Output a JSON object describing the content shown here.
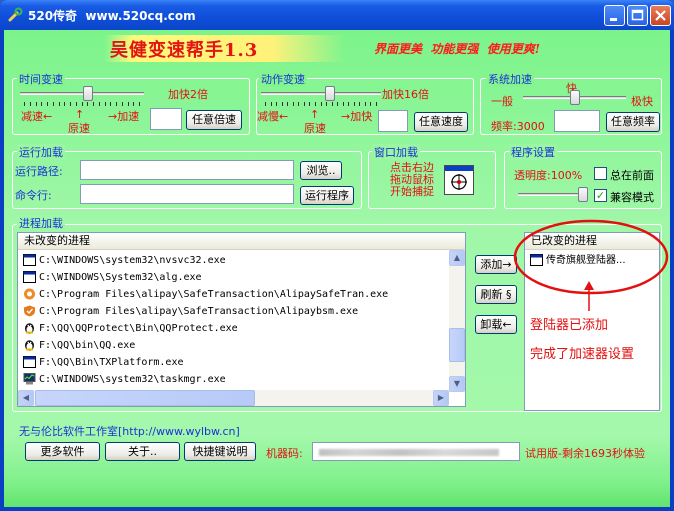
{
  "window": {
    "title": "520传奇  www.520cq.com",
    "banner": "吴健变速帮手1.3",
    "slogan": "界面更美  功能更强  使用更爽!"
  },
  "time_speed": {
    "label": "时间变速",
    "fast_label": "加快2倍",
    "decrease": "减速←",
    "original": "原速",
    "increase": "→加速",
    "value": "",
    "button": "任意倍速",
    "slider_fraction": 0.55
  },
  "action_speed": {
    "label": "动作变速",
    "fast_label": "加快16倍",
    "decrease": "减慢←",
    "original": "原速",
    "increase": "→加快",
    "value": "",
    "button": "任意速度",
    "slider_fraction": 0.58
  },
  "system_speed": {
    "label": "系统加速",
    "normal": "一般",
    "fast": "快",
    "very_fast": "极快",
    "frequency": "频率:3000",
    "value": "",
    "button": "任意频率",
    "slider_fraction": 0.5
  },
  "run_load": {
    "label": "运行加载",
    "path_label": "运行路径:",
    "path_value": "",
    "browse_button": "浏览..",
    "cmd_label": "命令行:",
    "cmd_value": "",
    "run_button": "运行程序"
  },
  "window_load": {
    "label": "窗口加载",
    "hint1": "点击右边",
    "hint2": "拖动鼠标",
    "hint3": "开始捕捉"
  },
  "program_settings": {
    "label": "程序设置",
    "transparency": "透明度:100%",
    "always_on_top": "总在前面",
    "always_on_top_checked": false,
    "compat_mode": "兼容模式",
    "compat_mode_checked": true,
    "slider_fraction": 1.0
  },
  "process_load": {
    "label": "进程加载",
    "unchanged_header": "未改变的进程",
    "unchanged": [
      {
        "icon": "window-icon",
        "path": "C:\\WINDOWS\\system32\\nvsvc32.exe"
      },
      {
        "icon": "window-icon",
        "path": "C:\\WINDOWS\\System32\\alg.exe"
      },
      {
        "icon": "alipay-icon",
        "path": "C:\\Program Files\\alipay\\SafeTransaction\\AlipaySafeTran.exe"
      },
      {
        "icon": "alipay-shield-icon",
        "path": "C:\\Program Files\\alipay\\SafeTransaction\\Alipaybsm.exe"
      },
      {
        "icon": "qq-penguin-icon",
        "path": "F:\\QQ\\QQProtect\\Bin\\QQProtect.exe"
      },
      {
        "icon": "qq-penguin-icon",
        "path": "F:\\QQ\\bin\\QQ.exe"
      },
      {
        "icon": "window-icon",
        "path": "F:\\QQ\\Bin\\TXPlatform.exe"
      },
      {
        "icon": "taskmgr-icon",
        "path": "C:\\WINDOWS\\system32\\taskmgr.exe"
      }
    ],
    "add_button": "添加→",
    "refresh_button": "刷新 §",
    "unload_button": "卸载←",
    "changed_header": "已改变的进程",
    "changed": [
      {
        "icon": "window-icon",
        "name": "传奇旗舰登陆器..."
      }
    ],
    "note1": "登陆器已添加",
    "note2": "完成了加速器设置",
    "scroll_fraction": 0.82
  },
  "footer": {
    "studio": "无与伦比软件工作室[http://www.wylbw.cn]",
    "more_button": "更多软件",
    "about_button": "关于..",
    "hotkey_button": "快捷键说明",
    "machine_code_label": "机器码:",
    "trial": "试用版-剩余1693秒体验"
  },
  "colors": {
    "accent_red": "#e31010",
    "label_blue": "#1a33d8",
    "annotation_red": "#e31010"
  }
}
